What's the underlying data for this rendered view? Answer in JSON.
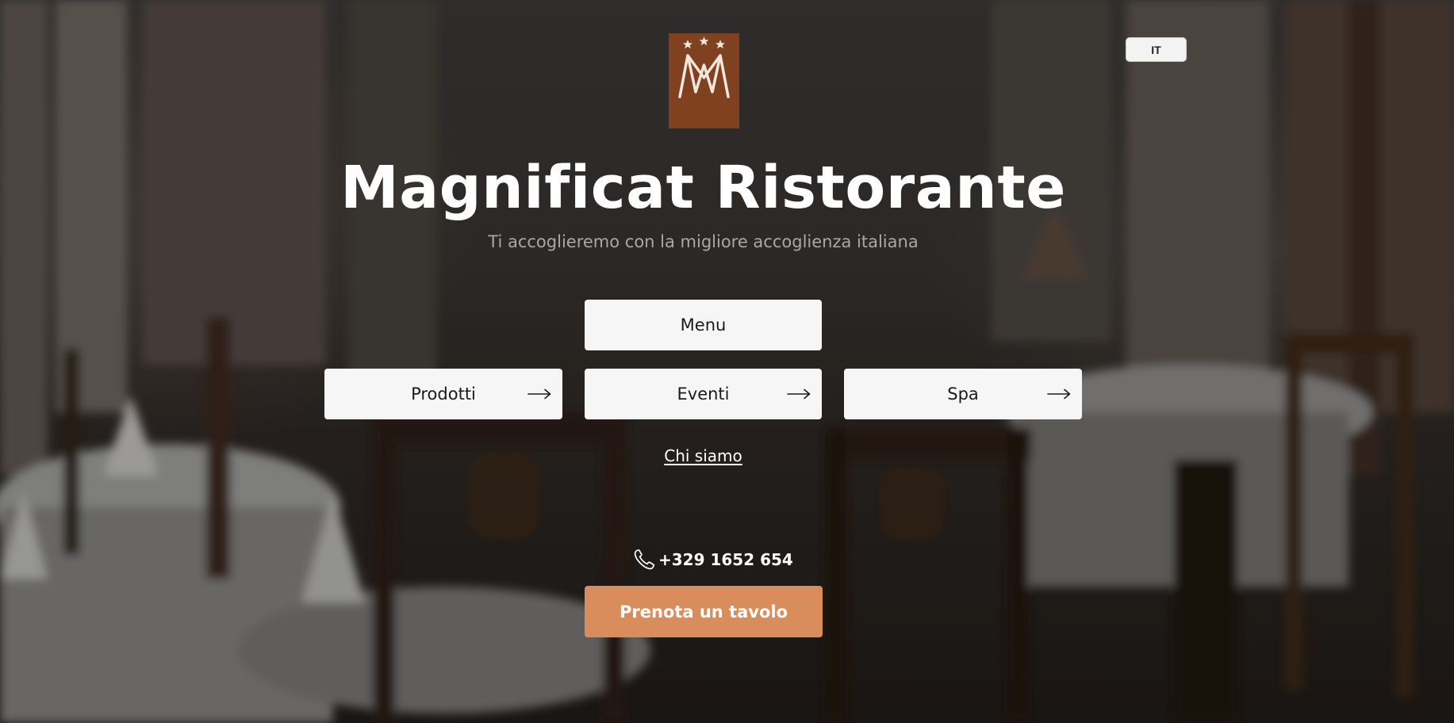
{
  "language": {
    "current": "IT"
  },
  "logo": {
    "icon": "magnificat-logo-icon",
    "wordmark_line1": "MAGNIFICAT",
    "wordmark_line2": "Ristorante",
    "color": "#7a3d1c"
  },
  "hero": {
    "title": "Magnificat Ristorante",
    "subtitle": "Ti accoglieremo con la migliore accoglienza italiana"
  },
  "nav": {
    "menu": "Menu",
    "prodotti": "Prodotti",
    "eventi": "Eventi",
    "spa": "Spa",
    "arrow_icon": "arrow-right-icon"
  },
  "about": {
    "label": "Chi siamo"
  },
  "contact": {
    "phone": "+329 1652 654",
    "icon": "phone-icon"
  },
  "cta": {
    "label": "Prenota un tavolo",
    "color": "#d98d5c"
  },
  "colors": {
    "button_bg": "#f6f6f6",
    "subtitle": "#a8a8a8",
    "accent": "#d98d5c"
  }
}
